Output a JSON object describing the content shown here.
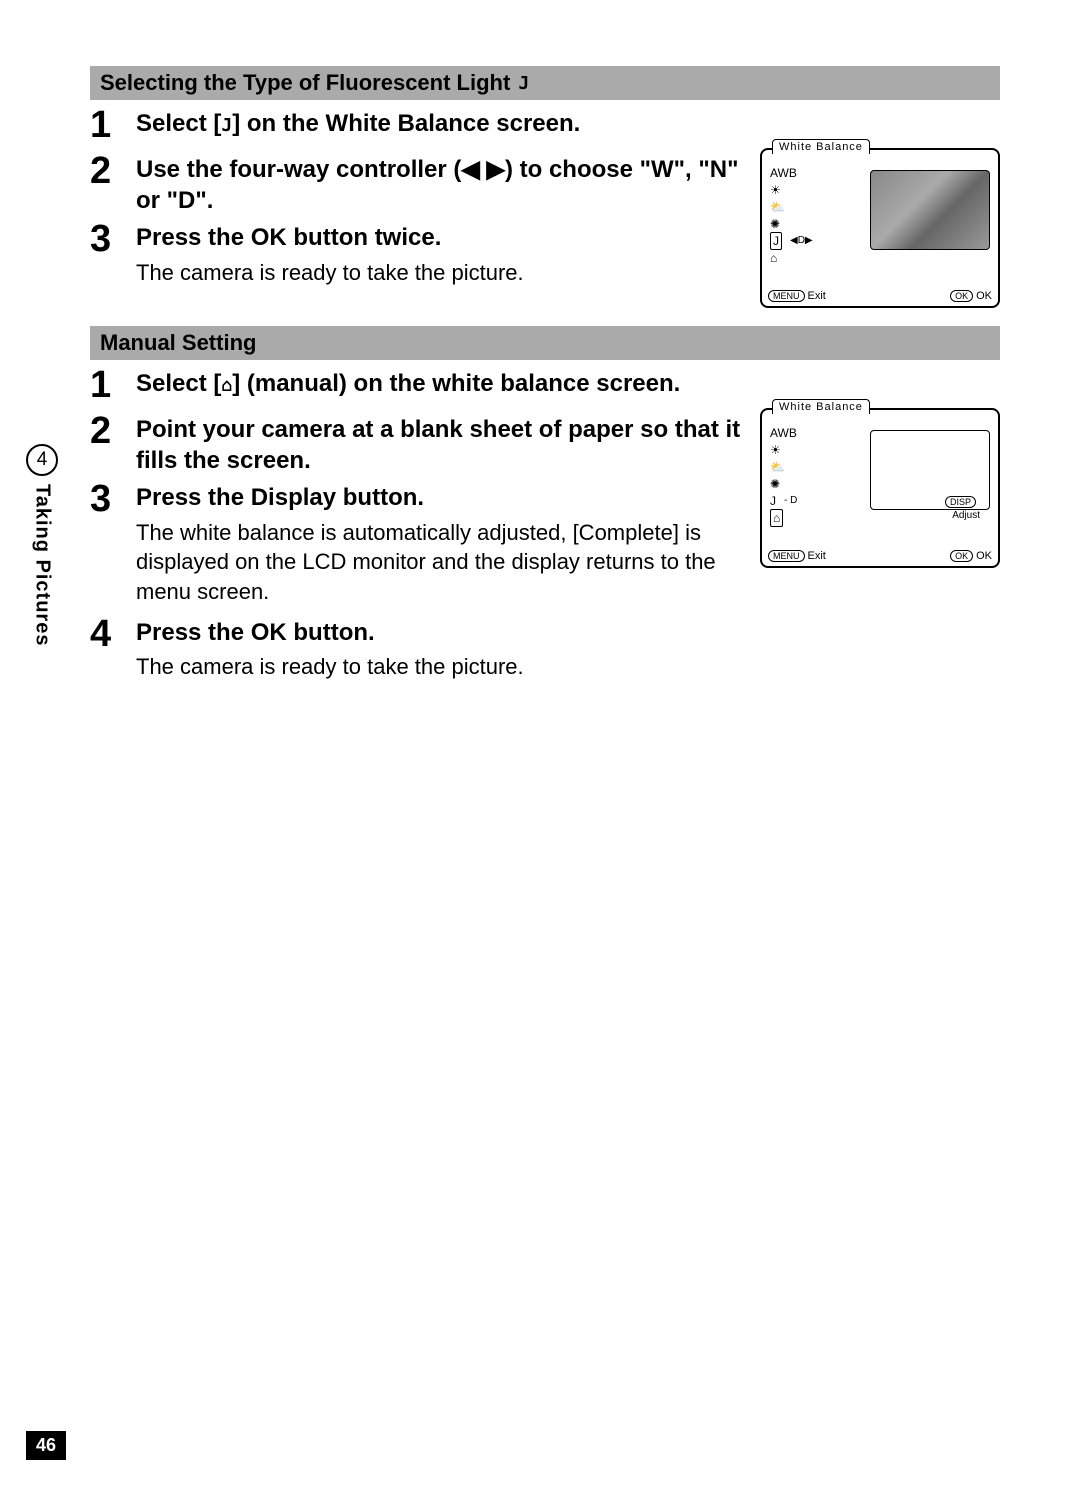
{
  "page": {
    "number": "46",
    "chapter_number": "4",
    "chapter_title": "Taking Pictures"
  },
  "section1": {
    "title": "Selecting the Type of Fluorescent Light",
    "icon": "J",
    "steps": [
      {
        "num": "1",
        "title_before": "Select [",
        "title_icon": "J",
        "title_after": "] on the White Balance screen."
      },
      {
        "num": "2",
        "title": "Use the four-way controller (◀ ▶) to choose \"W\", \"N\" or \"D\"."
      },
      {
        "num": "3",
        "title": "Press the OK button twice.",
        "desc": "The camera is ready to take the picture."
      }
    ],
    "figure": {
      "tab": "White Balance",
      "awb": "AWB",
      "row_icons": [
        "☀",
        "⛅",
        "✺",
        "J",
        "⌂"
      ],
      "selected_label": "◀D▶",
      "menu_label": "MENU",
      "exit": "Exit",
      "ok_label": "OK",
      "ok_button": "OK"
    }
  },
  "section2": {
    "title": "Manual Setting",
    "steps": [
      {
        "num": "1",
        "title_before": "Select [",
        "title_icon": "⌂",
        "title_after": "] (manual) on the white balance screen."
      },
      {
        "num": "2",
        "title": "Point your camera at a blank sheet of paper so that it fills the screen."
      },
      {
        "num": "3",
        "title": "Press the Display button.",
        "desc": "The white balance is automatically adjusted, [Complete] is displayed on the LCD monitor and the display returns to the menu screen."
      },
      {
        "num": "4",
        "title": "Press the OK button.",
        "desc": "The camera is ready to take the picture."
      }
    ],
    "figure": {
      "tab": "White Balance",
      "awb": "AWB",
      "row_icons": [
        "☀",
        "⛅",
        "✺",
        "J",
        "⌂"
      ],
      "mid_label": "- D",
      "disp": "DISP",
      "adjust": "Adjust",
      "menu_label": "MENU",
      "exit": "Exit",
      "ok_label": "OK",
      "ok_button": "OK"
    }
  }
}
